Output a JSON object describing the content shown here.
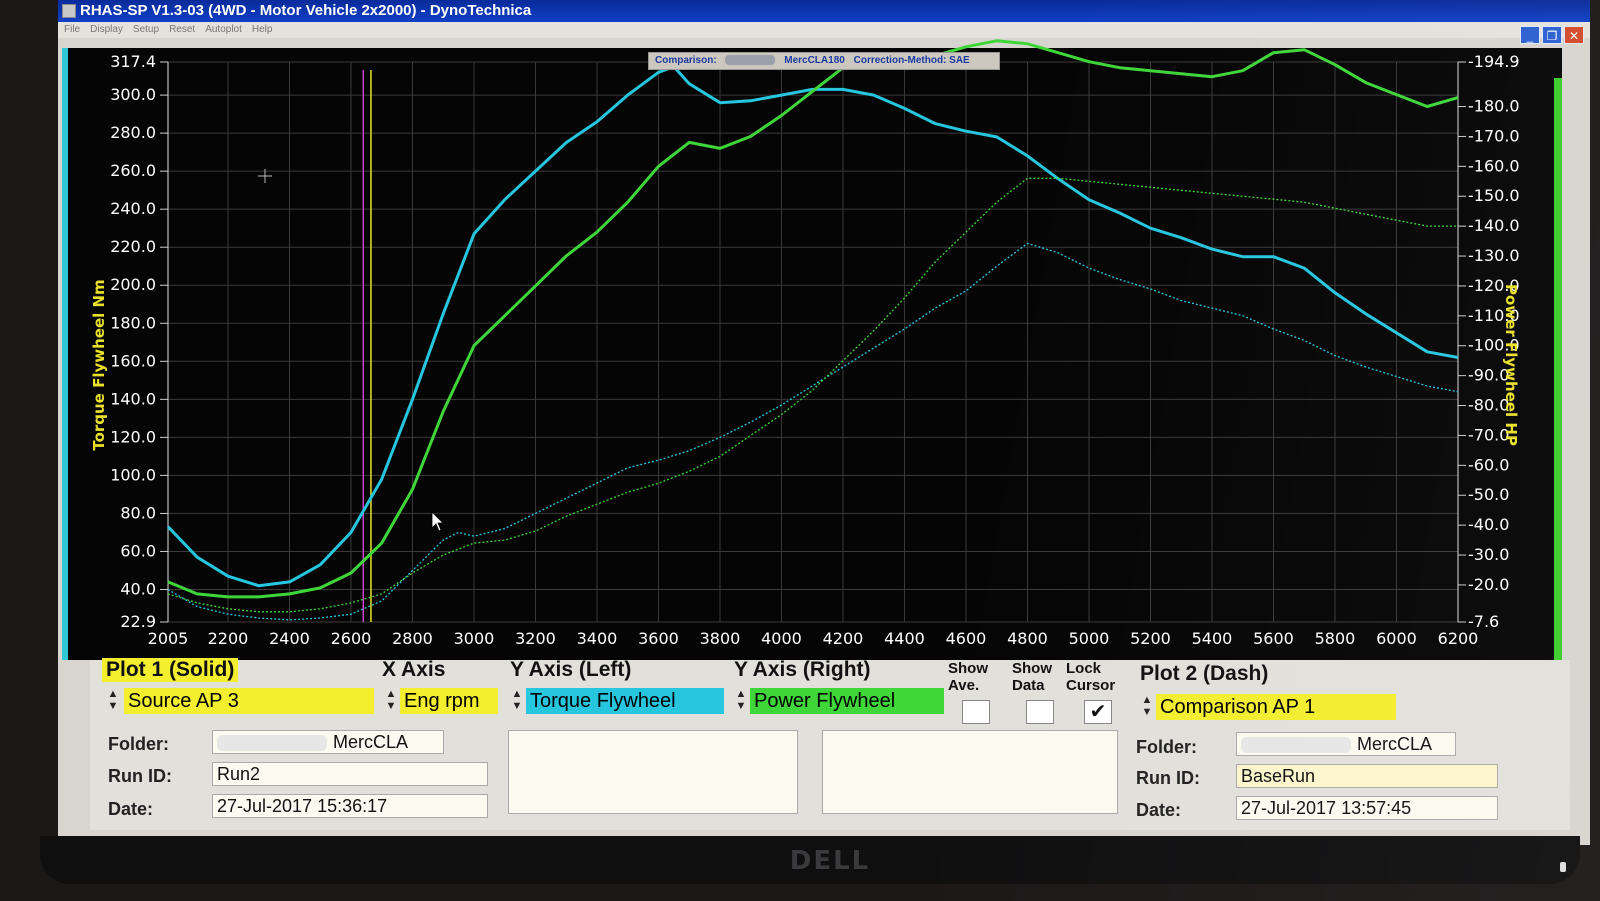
{
  "window": {
    "title": "RHAS-SP V1.3-03  (4WD - Motor Vehicle 2x2000) - DynoTechnica",
    "menu": [
      "File",
      "Display",
      "Setup",
      "Reset",
      "Autoplot",
      "Help"
    ],
    "minimize": "_",
    "restore": "❐",
    "close": "✕"
  },
  "comparison_bar": {
    "label": "Comparison:",
    "name": "MercCLA180",
    "method": "Correction-Method: SAE"
  },
  "chart_data": {
    "type": "line",
    "xlabel": "",
    "ylabel_left": "Torque Flywheel Nm",
    "ylabel_right": "Power Flywheel HP",
    "x_ticks": [
      "2005",
      "2200",
      "2400",
      "2600",
      "2800",
      "3000",
      "3200",
      "3400",
      "3600",
      "3800",
      "4000",
      "4200",
      "4400",
      "4600",
      "4800",
      "5000",
      "5200",
      "5400",
      "5600",
      "5800",
      "6000",
      "6200"
    ],
    "y_left_ticks": [
      "317.4",
      "300.0",
      "280.0",
      "260.0",
      "240.0",
      "220.0",
      "200.0",
      "180.0",
      "160.0",
      "140.0",
      "120.0",
      "100.0",
      "80.0",
      "60.0",
      "40.0",
      "22.9"
    ],
    "y_right_ticks": [
      "194.9",
      "180.0",
      "170.0",
      "160.0",
      "150.0",
      "140.0",
      "130.0",
      "120.0",
      "110.0",
      "100.0",
      "90.0",
      "80.0",
      "70.0",
      "60.0",
      "50.0",
      "40.0",
      "30.0",
      "20.0",
      "7.6"
    ],
    "xlim": [
      2005,
      6200
    ],
    "ylim_left": [
      22.9,
      317.4
    ],
    "ylim_right": [
      7.6,
      194.9
    ],
    "grid": true,
    "cursor_x": [
      2640,
      2665
    ],
    "series": [
      {
        "name": "Torque Flywheel",
        "axis": "left",
        "style": "solid",
        "color": "#27c6df",
        "x": [
          2005,
          2100,
          2200,
          2300,
          2400,
          2500,
          2600,
          2700,
          2800,
          2900,
          3000,
          3100,
          3200,
          3300,
          3400,
          3500,
          3600,
          3650,
          3700,
          3800,
          3900,
          4000,
          4100,
          4200,
          4300,
          4400,
          4500,
          4600,
          4700,
          4800,
          4900,
          5000,
          5100,
          5200,
          5300,
          5400,
          5500,
          5600,
          5700,
          5800,
          5900,
          6000,
          6100,
          6200
        ],
        "y": [
          73,
          57,
          47,
          42,
          44,
          53,
          70,
          98,
          140,
          185,
          227,
          245,
          260,
          275,
          286,
          300,
          312,
          315,
          306,
          296,
          297,
          300,
          303,
          303,
          300,
          293,
          285,
          281,
          278,
          268,
          256,
          245,
          238,
          230,
          225,
          219,
          215,
          215,
          209,
          196,
          185,
          175,
          165,
          162
        ]
      },
      {
        "name": "Power Flywheel",
        "axis": "right",
        "style": "solid",
        "color": "#3fd63a",
        "x": [
          2005,
          2100,
          2200,
          2300,
          2400,
          2500,
          2600,
          2700,
          2800,
          2900,
          3000,
          3100,
          3200,
          3300,
          3400,
          3500,
          3600,
          3700,
          3800,
          3900,
          4000,
          4100,
          4200,
          4300,
          4400,
          4500,
          4600,
          4700,
          4800,
          4900,
          5000,
          5100,
          5200,
          5300,
          5400,
          5500,
          5600,
          5700,
          5800,
          5900,
          6000,
          6100,
          6200
        ],
        "y": [
          21,
          17,
          16,
          16,
          17,
          19,
          24,
          34,
          52,
          78,
          100,
          110,
          120,
          130,
          138,
          148,
          160,
          168,
          166,
          170,
          177,
          185,
          193,
          196,
          196,
          197,
          200,
          202,
          201,
          198,
          195,
          193,
          192,
          191,
          190,
          192,
          198,
          199,
          194,
          188,
          184,
          180,
          183
        ]
      },
      {
        "name": "Torque Flywheel (Comparison)",
        "axis": "left",
        "style": "dash",
        "color": "#27c6df",
        "x": [
          2005,
          2100,
          2200,
          2300,
          2400,
          2500,
          2600,
          2700,
          2800,
          2900,
          2950,
          3000,
          3100,
          3200,
          3300,
          3400,
          3500,
          3600,
          3700,
          3800,
          3900,
          4000,
          4100,
          4200,
          4300,
          4400,
          4500,
          4600,
          4700,
          4800,
          4900,
          5000,
          5100,
          5200,
          5300,
          5400,
          5500,
          5600,
          5700,
          5800,
          5900,
          6000,
          6100,
          6200
        ],
        "y": [
          40,
          31,
          27,
          25,
          24,
          25,
          27,
          34,
          50,
          66,
          70,
          68,
          72,
          80,
          88,
          96,
          104,
          108,
          113,
          120,
          128,
          137,
          147,
          157,
          167,
          177,
          188,
          197,
          210,
          222,
          217,
          209,
          203,
          198,
          192,
          188,
          184,
          177,
          171,
          163,
          157,
          152,
          147,
          144
        ]
      },
      {
        "name": "Power Flywheel (Comparison)",
        "axis": "right",
        "style": "dash",
        "color": "#3fd63a",
        "x": [
          2005,
          2100,
          2200,
          2300,
          2400,
          2500,
          2600,
          2700,
          2800,
          2900,
          3000,
          3100,
          3200,
          3300,
          3400,
          3500,
          3600,
          3700,
          3800,
          3900,
          4000,
          4100,
          4200,
          4300,
          4400,
          4500,
          4600,
          4700,
          4800,
          4900,
          5000,
          5100,
          5200,
          5300,
          5400,
          5500,
          5600,
          5700,
          5800,
          5900,
          6000,
          6100,
          6200
        ],
        "y": [
          17,
          14,
          12,
          11,
          11,
          12,
          14,
          17,
          24,
          30,
          34,
          35,
          38,
          43,
          47,
          51,
          54,
          58,
          63,
          70,
          77,
          85,
          95,
          105,
          116,
          128,
          138,
          148,
          156,
          156,
          155,
          154,
          153,
          152,
          151,
          150,
          149,
          148,
          146,
          144,
          142,
          140,
          140
        ]
      }
    ]
  },
  "panel": {
    "plot1": {
      "title": "Plot 1 (Solid)",
      "source": "Source AP 3",
      "folder_label": "Folder:",
      "folder": "MercCLA",
      "runid_label": "Run ID:",
      "runid": "Run2",
      "date_label": "Date:",
      "date": "27-Jul-2017  15:36:17"
    },
    "x_axis": {
      "title": "X Axis",
      "value": "Eng rpm"
    },
    "y_left": {
      "title": "Y Axis (Left)",
      "value": "Torque Flywheel"
    },
    "y_right": {
      "title": "Y Axis (Right)",
      "value": "Power Flywheel"
    },
    "show_ave": {
      "label1": "Show",
      "label2": "Ave.",
      "checked": false
    },
    "show_data": {
      "label1": "Show",
      "label2": "Data",
      "checked": false
    },
    "lock_cursor": {
      "label1": "Lock",
      "label2": "Cursor",
      "checked": true,
      "mark": "✔"
    },
    "plot2": {
      "title": "Plot 2 (Dash)",
      "source": "Comparison AP 1",
      "folder_label": "Folder:",
      "folder": "MercCLA",
      "runid_label": "Run ID:",
      "runid": "BaseRun",
      "date_label": "Date:",
      "date": "27-Jul-2017  13:57:45"
    }
  },
  "monitor": {
    "brand": "DELL"
  },
  "colors": {
    "torque": "#27c6df",
    "power": "#3fd63a",
    "label_yellow": "#f3ee2e",
    "axis_label": "#e9e02a"
  }
}
